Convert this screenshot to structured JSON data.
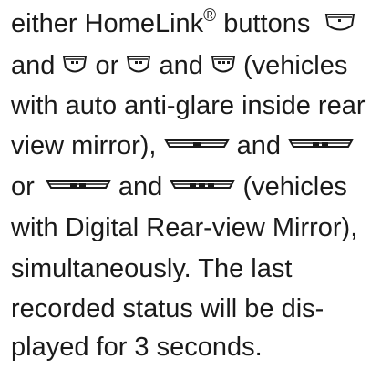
{
  "manual_text": {
    "line1": {
      "before": "either HomeLink",
      "reg": "®",
      "after": " buttons"
    },
    "line2": {
      "and1": "and",
      "or": "or",
      "and2": "and",
      "after": "(vehicles"
    },
    "line3": "with auto anti-glare inside rear",
    "line4": {
      "before": "view mirror),",
      "and": "and"
    },
    "line5": {
      "or": "or",
      "and": "and",
      "after": "(vehicles"
    },
    "line6": "with Digital Rear-view Mirror),",
    "line7": "simultaneously. The last",
    "line8": "recorded status will be dis-",
    "line9": "played for 3 seconds."
  },
  "icons": {
    "homelink_button_1": "homelink-button-1-dot",
    "homelink_button_2": "homelink-button-2-dots",
    "homelink_button_3": "homelink-button-3-dots",
    "digital_mirror_button_1": "digital-mirror-button-1-bar",
    "digital_mirror_button_2": "digital-mirror-button-2-bars",
    "digital_mirror_button_3": "digital-mirror-button-3-bars"
  }
}
